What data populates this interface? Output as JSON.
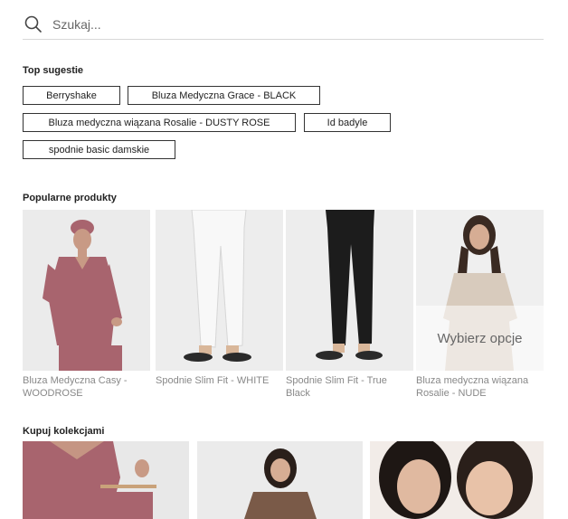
{
  "search": {
    "placeholder": "Szukaj..."
  },
  "suggestions": {
    "title": "Top sugestie",
    "items": [
      "Berryshake",
      "Bluza Medyczna Grace - BLACK",
      "Bluza medyczna wiązana Rosalie - DUSTY ROSE",
      "Id badyle",
      "spodnie basic damskie"
    ]
  },
  "products": {
    "title": "Popularne produkty",
    "items": [
      {
        "name": "Bluza Medyczna Casy - WOODROSE"
      },
      {
        "name": "Spodnie Slim Fit - WHITE"
      },
      {
        "name": "Spodnie Slim Fit - True Black"
      },
      {
        "name": "Bluza medyczna wiązana Rosalie - NUDE",
        "overlay": "Wybierz opcje"
      }
    ]
  },
  "collections": {
    "title": "Kupuj kolekcjami"
  },
  "colors": {
    "woodrose": "#a8646e",
    "white_pants": "#f4f4f4",
    "black_pants": "#1c1c1c",
    "nude": "#d8cbbd"
  }
}
